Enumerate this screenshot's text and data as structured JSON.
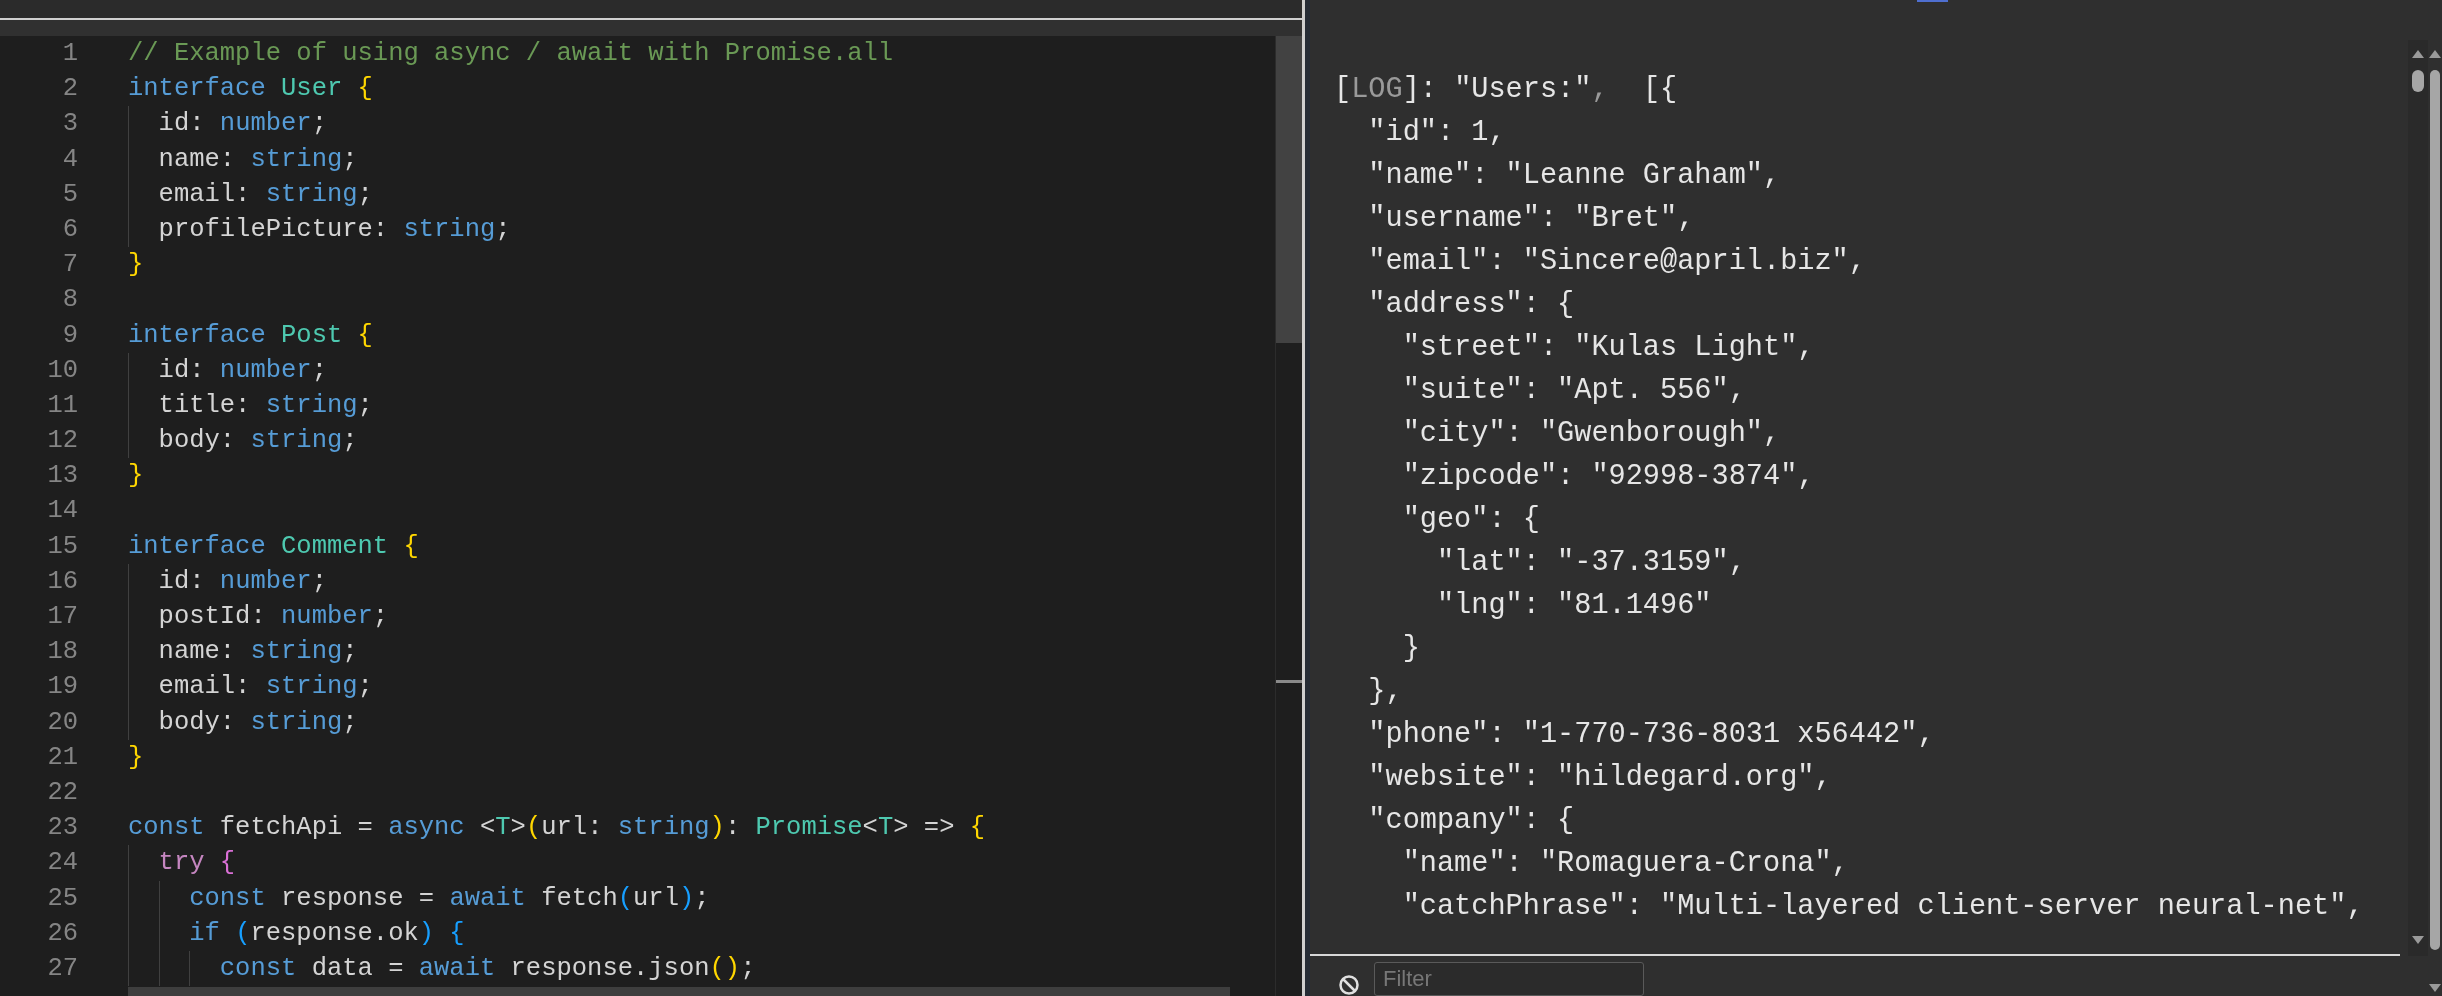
{
  "editor": {
    "lines": [
      {
        "number": "1",
        "tokens": [
          {
            "kind": "comment",
            "text": "// Example of using async / await with Promise.all"
          }
        ]
      },
      {
        "number": "2",
        "tokens": [
          {
            "kind": "keyword",
            "text": "interface"
          },
          {
            "kind": "type",
            "text": " User"
          },
          {
            "kind": "bracket1",
            "text": " {"
          }
        ]
      },
      {
        "number": "3",
        "tokens": [
          {
            "kind": "plain",
            "text": "  id: "
          },
          {
            "kind": "keyword",
            "text": "number"
          },
          {
            "kind": "plain",
            "text": ";"
          }
        ]
      },
      {
        "number": "4",
        "tokens": [
          {
            "kind": "plain",
            "text": "  name: "
          },
          {
            "kind": "keyword",
            "text": "string"
          },
          {
            "kind": "plain",
            "text": ";"
          }
        ]
      },
      {
        "number": "5",
        "tokens": [
          {
            "kind": "plain",
            "text": "  email: "
          },
          {
            "kind": "keyword",
            "text": "string"
          },
          {
            "kind": "plain",
            "text": ";"
          }
        ]
      },
      {
        "number": "6",
        "tokens": [
          {
            "kind": "plain",
            "text": "  profilePicture: "
          },
          {
            "kind": "keyword",
            "text": "string"
          },
          {
            "kind": "plain",
            "text": ";"
          }
        ]
      },
      {
        "number": "7",
        "tokens": [
          {
            "kind": "bracket1",
            "text": "}"
          }
        ]
      },
      {
        "number": "8"
      },
      {
        "number": "9",
        "tokens": [
          {
            "kind": "keyword",
            "text": "interface"
          },
          {
            "kind": "type",
            "text": " Post"
          },
          {
            "kind": "bracket1",
            "text": " {"
          }
        ]
      },
      {
        "number": "10",
        "tokens": [
          {
            "kind": "plain",
            "text": "  id: "
          },
          {
            "kind": "keyword",
            "text": "number"
          },
          {
            "kind": "plain",
            "text": ";"
          }
        ]
      },
      {
        "number": "11",
        "tokens": [
          {
            "kind": "plain",
            "text": "  title: "
          },
          {
            "kind": "keyword",
            "text": "string"
          },
          {
            "kind": "plain",
            "text": ";"
          }
        ]
      },
      {
        "number": "12",
        "tokens": [
          {
            "kind": "plain",
            "text": "  body: "
          },
          {
            "kind": "keyword",
            "text": "string"
          },
          {
            "kind": "plain",
            "text": ";"
          }
        ]
      },
      {
        "number": "13",
        "tokens": [
          {
            "kind": "bracket1",
            "text": "}"
          }
        ]
      },
      {
        "number": "14"
      },
      {
        "number": "15",
        "tokens": [
          {
            "kind": "keyword",
            "text": "interface"
          },
          {
            "kind": "type",
            "text": " Comment"
          },
          {
            "kind": "bracket1",
            "text": " {"
          }
        ]
      },
      {
        "number": "16",
        "tokens": [
          {
            "kind": "plain",
            "text": "  id: "
          },
          {
            "kind": "keyword",
            "text": "number"
          },
          {
            "kind": "plain",
            "text": ";"
          }
        ]
      },
      {
        "number": "17",
        "tokens": [
          {
            "kind": "plain",
            "text": "  postId: "
          },
          {
            "kind": "keyword",
            "text": "number"
          },
          {
            "kind": "plain",
            "text": ";"
          }
        ]
      },
      {
        "number": "18",
        "tokens": [
          {
            "kind": "plain",
            "text": "  name: "
          },
          {
            "kind": "keyword",
            "text": "string"
          },
          {
            "kind": "plain",
            "text": ";"
          }
        ]
      },
      {
        "number": "19",
        "tokens": [
          {
            "kind": "plain",
            "text": "  email: "
          },
          {
            "kind": "keyword",
            "text": "string"
          },
          {
            "kind": "plain",
            "text": ";"
          }
        ]
      },
      {
        "number": "20",
        "tokens": [
          {
            "kind": "plain",
            "text": "  body: "
          },
          {
            "kind": "keyword",
            "text": "string"
          },
          {
            "kind": "plain",
            "text": ";"
          }
        ]
      },
      {
        "number": "21",
        "tokens": [
          {
            "kind": "bracket1",
            "text": "}"
          }
        ]
      },
      {
        "number": "22"
      },
      {
        "number": "23",
        "tokens": [
          {
            "kind": "keyword",
            "text": "const"
          },
          {
            "kind": "plain",
            "text": " fetchApi = "
          },
          {
            "kind": "keyword",
            "text": "async"
          },
          {
            "kind": "plain",
            "text": " <"
          },
          {
            "kind": "type",
            "text": "T"
          },
          {
            "kind": "plain",
            "text": ">"
          },
          {
            "kind": "bracket1",
            "text": "("
          },
          {
            "kind": "plain",
            "text": "url: "
          },
          {
            "kind": "keyword",
            "text": "string"
          },
          {
            "kind": "bracket1",
            "text": ")"
          },
          {
            "kind": "plain",
            "text": ": "
          },
          {
            "kind": "type",
            "text": "Promise"
          },
          {
            "kind": "plain",
            "text": "<"
          },
          {
            "kind": "type",
            "text": "T"
          },
          {
            "kind": "plain",
            "text": "> => "
          },
          {
            "kind": "bracket1",
            "text": "{"
          }
        ]
      },
      {
        "number": "24",
        "tokens": [
          {
            "kind": "control",
            "text": "  try"
          },
          {
            "kind": "bracket2",
            "text": " {"
          }
        ]
      },
      {
        "number": "25",
        "tokens": [
          {
            "kind": "keyword",
            "text": "    const"
          },
          {
            "kind": "plain",
            "text": " response = "
          },
          {
            "kind": "keyword",
            "text": "await"
          },
          {
            "kind": "plain",
            "text": " fetch"
          },
          {
            "kind": "bracket3",
            "text": "("
          },
          {
            "kind": "plain",
            "text": "url"
          },
          {
            "kind": "bracket3",
            "text": ")"
          },
          {
            "kind": "plain",
            "text": ";"
          }
        ]
      },
      {
        "number": "26",
        "tokens": [
          {
            "kind": "keyword",
            "text": "    if"
          },
          {
            "kind": "bracket3",
            "text": " ("
          },
          {
            "kind": "plain",
            "text": "response.ok"
          },
          {
            "kind": "bracket3",
            "text": ") {"
          }
        ]
      },
      {
        "number": "27",
        "tokens": [
          {
            "kind": "keyword",
            "text": "      const"
          },
          {
            "kind": "plain",
            "text": " data = "
          },
          {
            "kind": "keyword",
            "text": "await"
          },
          {
            "kind": "plain",
            "text": " response.json"
          },
          {
            "kind": "bracket1",
            "text": "()"
          },
          {
            "kind": "plain",
            "text": ";"
          }
        ]
      }
    ]
  },
  "console": {
    "lines": [
      {
        "tokens": [
          {
            "kind": "plain",
            "text": "["
          },
          {
            "kind": "dim",
            "text": "LOG"
          },
          {
            "kind": "plain",
            "text": "]: \"Users:\""
          },
          {
            "kind": "dim",
            "text": ","
          },
          {
            "kind": "plain",
            "text": "  [{"
          }
        ]
      },
      {
        "tokens": [
          {
            "kind": "plain",
            "text": "  \"id\": 1,"
          }
        ]
      },
      {
        "tokens": [
          {
            "kind": "plain",
            "text": "  \"name\": \"Leanne Graham\","
          }
        ]
      },
      {
        "tokens": [
          {
            "kind": "plain",
            "text": "  \"username\": \"Bret\","
          }
        ]
      },
      {
        "tokens": [
          {
            "kind": "plain",
            "text": "  \"email\": \"Sincere@april.biz\","
          }
        ]
      },
      {
        "tokens": [
          {
            "kind": "plain",
            "text": "  \"address\": {"
          }
        ]
      },
      {
        "tokens": [
          {
            "kind": "plain",
            "text": "    \"street\": \"Kulas Light\","
          }
        ]
      },
      {
        "tokens": [
          {
            "kind": "plain",
            "text": "    \"suite\": \"Apt. 556\","
          }
        ]
      },
      {
        "tokens": [
          {
            "kind": "plain",
            "text": "    \"city\": \"Gwenborough\","
          }
        ]
      },
      {
        "tokens": [
          {
            "kind": "plain",
            "text": "    \"zipcode\": \"92998-3874\","
          }
        ]
      },
      {
        "tokens": [
          {
            "kind": "plain",
            "text": "    \"geo\": {"
          }
        ]
      },
      {
        "tokens": [
          {
            "kind": "plain",
            "text": "      \"lat\": \"-37.3159\","
          }
        ]
      },
      {
        "tokens": [
          {
            "kind": "plain",
            "text": "      \"lng\": \"81.1496\""
          }
        ]
      },
      {
        "tokens": [
          {
            "kind": "plain",
            "text": "    }"
          }
        ]
      },
      {
        "tokens": [
          {
            "kind": "plain",
            "text": "  },"
          }
        ]
      },
      {
        "tokens": [
          {
            "kind": "plain",
            "text": "  \"phone\": \"1-770-736-8031 x56442\","
          }
        ]
      },
      {
        "tokens": [
          {
            "kind": "plain",
            "text": "  \"website\": \"hildegard.org\","
          }
        ]
      },
      {
        "tokens": [
          {
            "kind": "plain",
            "text": "  \"company\": {"
          }
        ]
      },
      {
        "tokens": [
          {
            "kind": "plain",
            "text": "    \"name\": \"Romaguera-Crona\","
          }
        ]
      },
      {
        "tokens": [
          {
            "kind": "plain",
            "text": "    \"catchPhrase\": \"Multi-layered client-server neural-net\","
          }
        ]
      }
    ],
    "filter": {
      "placeholder": "Filter"
    }
  }
}
